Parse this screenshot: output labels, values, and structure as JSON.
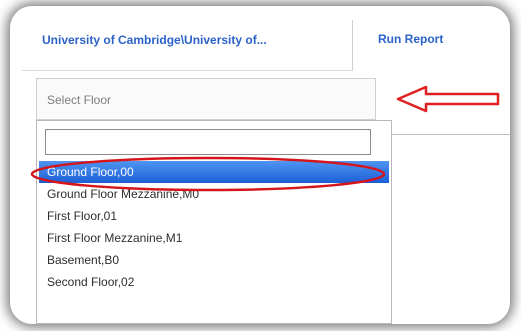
{
  "header": {
    "organization_link": "University of Cambridge\\University of...",
    "run_report_label": "Run Report"
  },
  "floor_select": {
    "placeholder": "Select Floor",
    "filter_value": "",
    "options": [
      {
        "label": "Ground Floor,00",
        "selected": true
      },
      {
        "label": "Ground Floor Mezzanine,M0",
        "selected": false
      },
      {
        "label": "First Floor,01",
        "selected": false
      },
      {
        "label": "First Floor Mezzanine,M1",
        "selected": false
      },
      {
        "label": "Basement,B0",
        "selected": false
      },
      {
        "label": "Second Floor,02",
        "selected": false
      }
    ]
  },
  "annotations": {
    "arrow_color": "#e02020",
    "highlight_ellipse_color": "#d4161c",
    "selection_color": "#2a6fe0"
  }
}
